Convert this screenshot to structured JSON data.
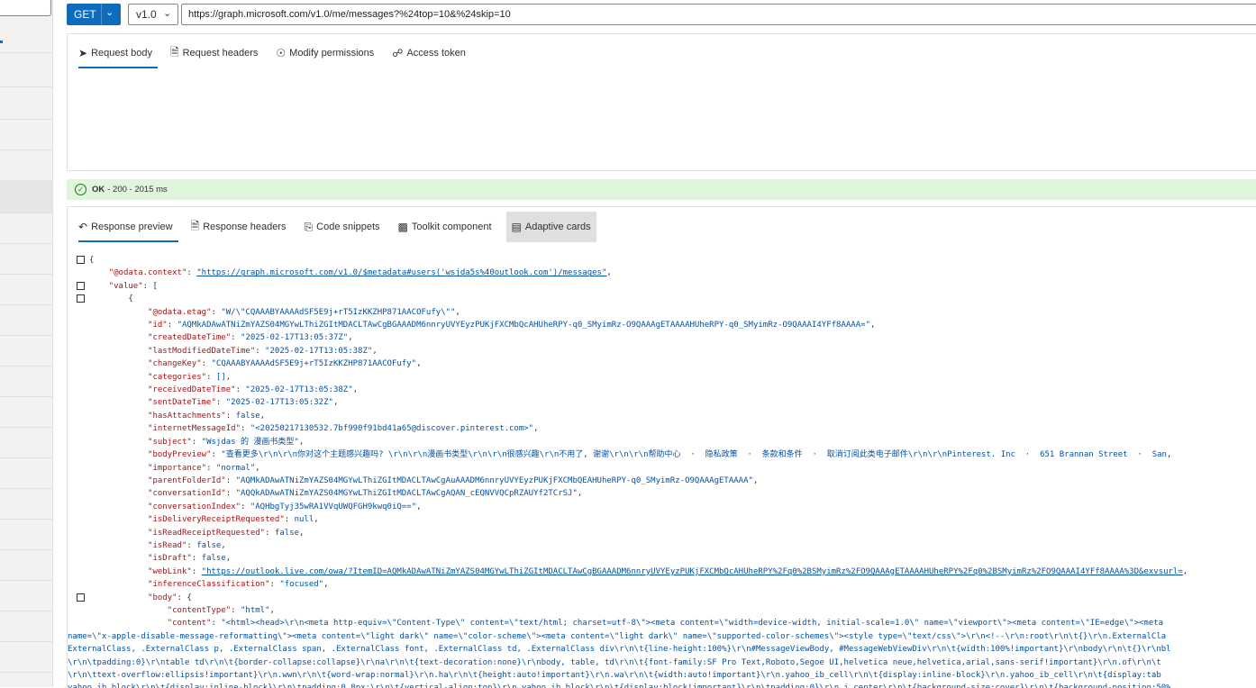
{
  "request": {
    "method": "GET",
    "version": "v1.0",
    "url": "https://graph.microsoft.com/v1.0/me/messages?%24top=10&%24skip=10"
  },
  "request_tabs": [
    {
      "label": "Request body",
      "icon": "send-icon"
    },
    {
      "label": "Request headers",
      "icon": "document-icon"
    },
    {
      "label": "Modify permissions",
      "icon": "shield-icon"
    },
    {
      "label": "Access token",
      "icon": "lock-icon"
    }
  ],
  "status": {
    "ok": "OK",
    "detail": "- 200 - 2015 ms",
    "color": "#dff6dd"
  },
  "response_tabs": [
    {
      "label": "Response preview",
      "icon": "undo-arrow-icon"
    },
    {
      "label": "Response headers",
      "icon": "document-icon"
    },
    {
      "label": "Code snippets",
      "icon": "code-file-icon"
    },
    {
      "label": "Toolkit component",
      "icon": "component-icon"
    },
    {
      "label": "Adaptive cards",
      "icon": "card-icon"
    }
  ],
  "json": {
    "open_brace": "{",
    "context_key": "\"@odata.context\"",
    "context_val": "\"https://graph.microsoft.com/v1.0/$metadata#users('wsjda5s%40outlook.com')/messages\"",
    "value_key": "\"value\"",
    "value_open": ": [",
    "item_open": "{",
    "fields": [
      {
        "k": "\"@odata.etag\"",
        "v": "\"W/\\\"CQAAABYAAAAdSF5E9j+rT5IzKKZHP871AACOFufy\\\"\"",
        "t": "s"
      },
      {
        "k": "\"id\"",
        "v": "\"AQMkADAwATNiZmYAZS04MGYwLThiZGItMDACLTAwCgBGAAADM6nnryUVYEyzPUKjFXCMbQcAHUheRPY-q0_SMyimRz-O9QAAAgETAAAAHUheRPY-q0_SMyimRz-O9QAAAI4YFf8AAAA=\"",
        "t": "s"
      },
      {
        "k": "\"createdDateTime\"",
        "v": "\"2025-02-17T13:05:37Z\"",
        "t": "s"
      },
      {
        "k": "\"lastModifiedDateTime\"",
        "v": "\"2025-02-17T13:05:38Z\"",
        "t": "s"
      },
      {
        "k": "\"changeKey\"",
        "v": "\"CQAAABYAAAAdSF5E9j+rT5IzKKZHP871AACOFufy\"",
        "t": "s"
      },
      {
        "k": "\"categories\"",
        "v": "[]",
        "t": "p"
      },
      {
        "k": "\"receivedDateTime\"",
        "v": "\"2025-02-17T13:05:38Z\"",
        "t": "s"
      },
      {
        "k": "\"sentDateTime\"",
        "v": "\"2025-02-17T13:05:32Z\"",
        "t": "s"
      },
      {
        "k": "\"hasAttachments\"",
        "v": "false",
        "t": "n"
      },
      {
        "k": "\"internetMessageId\"",
        "v": "\"<20250217130532.7bf990f91bd41a65@discover.pinterest.com>\"",
        "t": "s"
      },
      {
        "k": "\"subject\"",
        "v": "\"Wsjdas 的 漫画书类型\"",
        "t": "s"
      },
      {
        "k": "\"bodyPreview\"",
        "v": "\"查看更多\\r\\n\\r\\n你对这个主题感兴趣吗? \\r\\n\\r\\n漫画书类型\\r\\n\\r\\n很感兴趣\\r\\n不用了, 谢谢\\r\\n\\r\\n帮助中心  ·  隐私政策  ·  条款和条件  ·  取消订阅此类电子邮件\\r\\n\\r\\nPinterest. Inc  ·  651 Brannan Street  ·  San",
        "t": "s"
      },
      {
        "k": "\"importance\"",
        "v": "\"normal\"",
        "t": "s"
      },
      {
        "k": "\"parentFolderId\"",
        "v": "\"AQMkADAwATNiZmYAZS04MGYwLThiZGItMDACLTAwCgAuAAADM6nnryUVYEyzPUKjFXCMbQEAHUheRPY-q0_SMyimRz-O9QAAAgETAAAA\"",
        "t": "s"
      },
      {
        "k": "\"conversationId\"",
        "v": "\"AQQkADAwATNiZmYAZS04MGYwLThiZGItMDACLTAwCgAQAN_cEQNVVQCpRZAUYf2TCrSJ\"",
        "t": "s"
      },
      {
        "k": "\"conversationIndex\"",
        "v": "\"AQHbgTyj35wRA1VVqUWQFGH9kwq0iQ==\"",
        "t": "s"
      },
      {
        "k": "\"isDeliveryReceiptRequested\"",
        "v": "null",
        "t": "n"
      },
      {
        "k": "\"isReadReceiptRequested\"",
        "v": "false",
        "t": "n"
      },
      {
        "k": "\"isRead\"",
        "v": "false",
        "t": "n"
      },
      {
        "k": "\"isDraft\"",
        "v": "false",
        "t": "n"
      },
      {
        "k": "\"webLink\"",
        "v": "\"https://outlook.live.com/owa/?ItemID=AQMkADAwATNiZmYAZS04MGYwLThiZGItMDACLTAwCgBGAAADM6nnryUVYEyzPUKjFXCMbQcAHUheRPY%2Fq0%2BSMyimRz%2FO9QAAAgETAAAAHUheRPY%2Fq0%2BSMyimRz%2FO9QAAAI4YFf8AAAA%3D&exvsurl=",
        "t": "u"
      },
      {
        "k": "\"inferenceClassification\"",
        "v": "\"focused\"",
        "t": "s"
      }
    ],
    "body_key": "\"body\"",
    "body_open": ": {",
    "content_type_key": "\"contentType\"",
    "content_type_val": "\"html\"",
    "content_key": "\"content\"",
    "content_val": "\"<html><head>\\r\\n<meta http-equiv=\\\"Content-Type\\\" content=\\\"text/html; charset=utf-8\\\"><meta content=\\\"width=device-width, initial-scale=1.0\\\" name=\\\"viewport\\\"><meta content=\\\"IE=edge\\\"><meta",
    "content_cont": [
      "name=\\\"x-apple-disable-message-reformatting\\\"><meta content=\\\"light dark\\\" name=\\\"color-scheme\\\"><meta content=\\\"light dark\\\" name=\\\"supported-color-schemes\\\"><style type=\\\"text/css\\\">\\r\\n<!--\\r\\n:root\\r\\n\\t{}\\r\\n.ExternalCla",
      "ExternalClass, .ExternalClass p, .ExternalClass span, .ExternalClass font, .ExternalClass td, .ExternalClass div\\r\\n\\t{line-height:100%}\\r\\n#MessageViewBody, #MessageWebViewDiv\\r\\n\\t{width:100%!important}\\r\\nbody\\r\\n\\t{}\\r\\nbl",
      "\\r\\n\\tpadding:0}\\r\\ntable td\\r\\n\\t{border-collapse:collapse}\\r\\na\\r\\n\\t{text-decoration:none}\\r\\nbody, table, td\\r\\n\\t{font-family:SF Pro Text,Roboto,Segoe UI,helvetica neue,helvetica,arial,sans-serif!important}\\r\\n.of\\r\\n\\t",
      "\\r\\n\\ttext-overflow:ellipsis!important}\\r\\n.wwn\\r\\n\\t{word-wrap:normal}\\r\\n.ha\\r\\n\\t{height:auto!important}\\r\\n.wa\\r\\n\\t{width:auto!important}\\r\\n.yahoo_ib_cell\\r\\n\\t{display:inline-block}\\r\\n.yahoo_ib_cell\\r\\n\\t{display:tab",
      "yahoo_ib_block\\r\\n\\t{display:inline-block}\\r\\n\\tpadding:0.8px;\\r\\n\\t{vertical-align:top}\\r\\n.yahoo_ib_block\\r\\n\\t{display:block!important}\\r\\n\\tpadding:0}\\r\\n.i_center\\r\\n\\t{background-size:cover}\\r\\n\\t{background-position:50%"
    ]
  }
}
